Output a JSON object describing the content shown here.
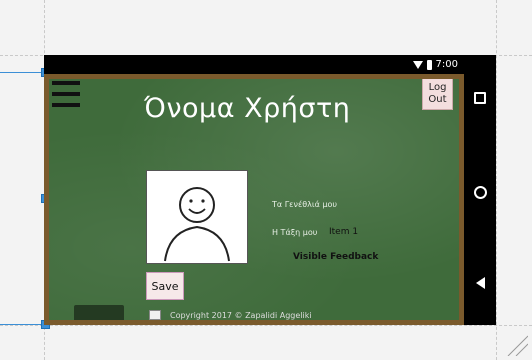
{
  "status_bar": {
    "time": "7:00"
  },
  "app": {
    "title": "Όνομα Χρήστη",
    "logout_line1": "Log",
    "logout_line2": "Out",
    "save_label": "Save",
    "hobbies_label": "Τα Γενέθλιά μου",
    "class_label": "Η Τάξη μου",
    "class_spinner_value": "Item 1",
    "feedback_text": "Visible Feedback",
    "copyright_text": "Copyright 2017 ©    Zapalidi Aggeliki"
  },
  "colors": {
    "chalkboard": "#3f6b3b",
    "frame": "#7a5a2c",
    "selection": "#3b8fd6"
  },
  "icons": [
    "menu-icon",
    "wifi-icon",
    "battery-icon",
    "recent-apps-icon",
    "home-icon",
    "back-icon",
    "smiley-avatar-icon",
    "resize-grip-icon"
  ]
}
